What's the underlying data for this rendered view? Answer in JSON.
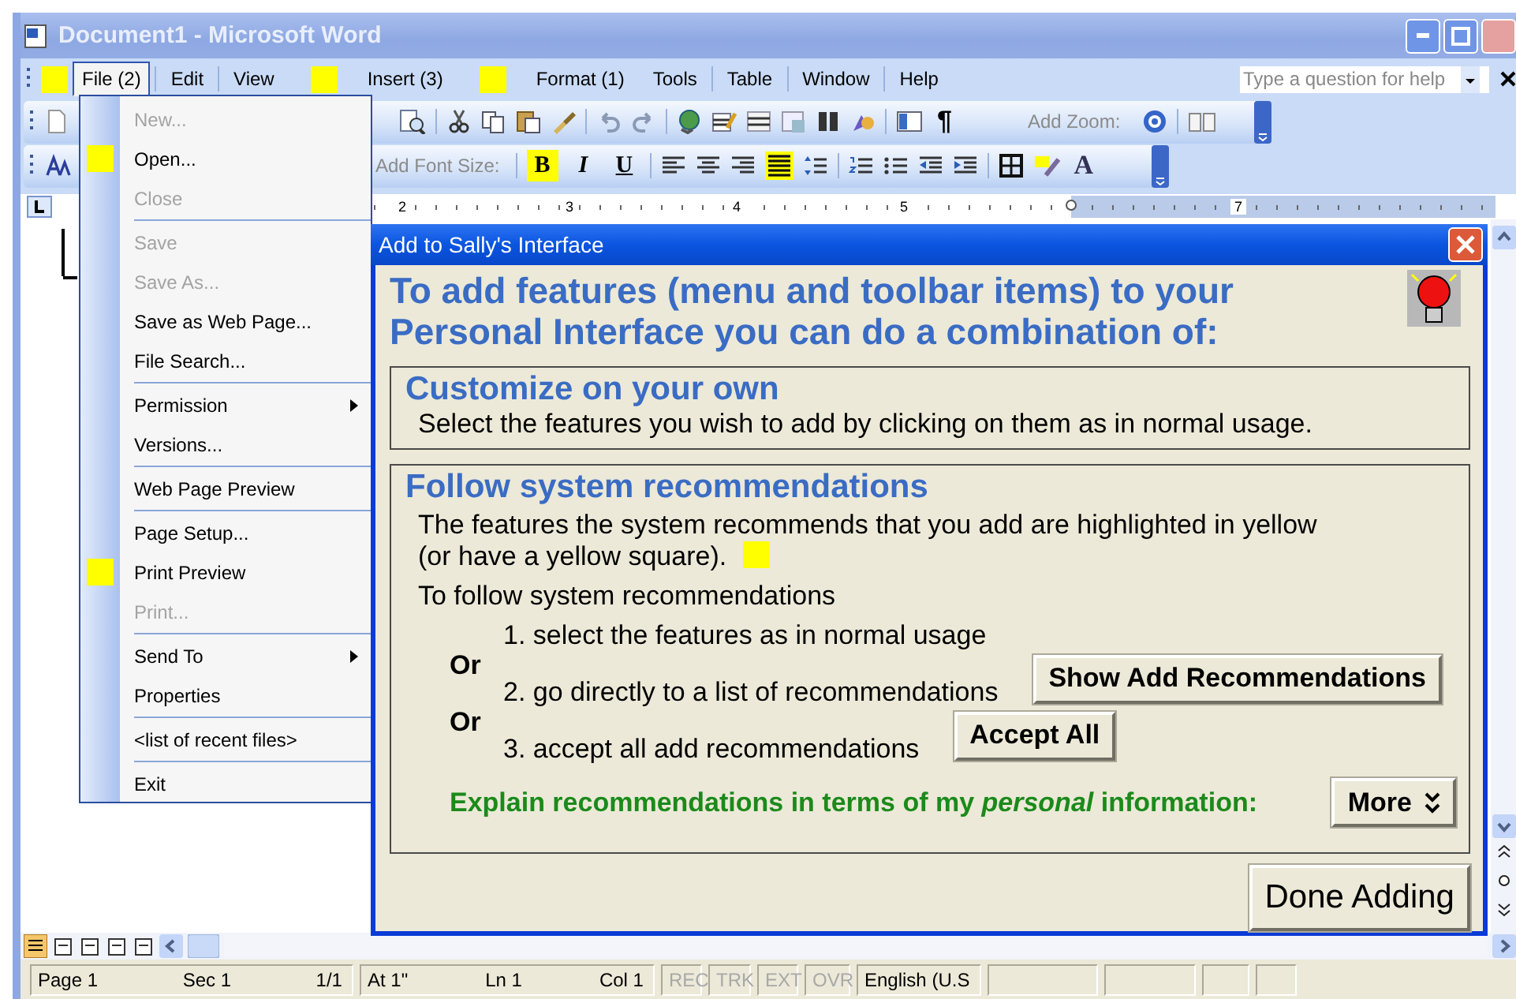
{
  "window": {
    "title": "Document1 - Microsoft Word"
  },
  "menu_bar": {
    "items": [
      {
        "label": "File (2)",
        "recommended": true,
        "selected": true
      },
      {
        "label": "Edit",
        "recommended": false,
        "selected": false
      },
      {
        "label": "View",
        "recommended": false,
        "selected": false
      },
      {
        "label": "Insert (3)",
        "recommended": true,
        "selected": false
      },
      {
        "label": "Format (1)",
        "recommended": true,
        "selected": false
      },
      {
        "label": "Tools",
        "recommended": false,
        "selected": false
      },
      {
        "label": "Table",
        "recommended": false,
        "selected": false
      },
      {
        "label": "Window",
        "recommended": false,
        "selected": false
      },
      {
        "label": "Help",
        "recommended": false,
        "selected": false
      }
    ],
    "help_search": {
      "placeholder": "Type a question for help"
    }
  },
  "standard_toolbar": {
    "pilcrow": "¶",
    "zoom_label": "Add Zoom:"
  },
  "formatting_toolbar": {
    "font_size_label": "Add Font Size:",
    "text_buttons": [
      {
        "label": "B",
        "recommended": true
      },
      {
        "label": "I",
        "recommended": false
      },
      {
        "label": "U",
        "recommended": false
      }
    ],
    "justify_recommended": true,
    "font_color_label": "A"
  },
  "ruler": {
    "marks": [
      {
        "kind": "number",
        "label": "2"
      },
      {
        "kind": "number",
        "label": "3"
      },
      {
        "kind": "number",
        "label": "4"
      },
      {
        "kind": "number",
        "label": "5"
      },
      {
        "kind": "indent-marker"
      },
      {
        "kind": "number",
        "label": "7"
      }
    ]
  },
  "file_menu": {
    "groups": [
      [
        {
          "label": "New...",
          "disabled": true,
          "recommended": false,
          "submenu": false
        },
        {
          "label": "Open...",
          "disabled": false,
          "recommended": true,
          "submenu": false
        },
        {
          "label": "Close",
          "disabled": true,
          "recommended": false,
          "submenu": false
        }
      ],
      [
        {
          "label": "Save",
          "disabled": true,
          "recommended": false,
          "submenu": false
        },
        {
          "label": "Save As...",
          "disabled": true,
          "recommended": false,
          "submenu": false
        },
        {
          "label": "Save as Web Page...",
          "disabled": false,
          "recommended": false,
          "submenu": false
        },
        {
          "label": "File Search...",
          "disabled": false,
          "recommended": false,
          "submenu": false
        }
      ],
      [
        {
          "label": "Permission",
          "disabled": false,
          "recommended": false,
          "submenu": true
        },
        {
          "label": "Versions...",
          "disabled": false,
          "recommended": false,
          "submenu": false
        }
      ],
      [
        {
          "label": "Web Page Preview",
          "disabled": false,
          "recommended": false,
          "submenu": false
        }
      ],
      [
        {
          "label": "Page Setup...",
          "disabled": false,
          "recommended": false,
          "submenu": false
        },
        {
          "label": "Print Preview",
          "disabled": false,
          "recommended": true,
          "submenu": false
        },
        {
          "label": "Print...",
          "disabled": true,
          "recommended": false,
          "submenu": false
        }
      ],
      [
        {
          "label": "Send To",
          "disabled": false,
          "recommended": false,
          "submenu": true
        },
        {
          "label": "Properties",
          "disabled": false,
          "recommended": false,
          "submenu": false
        }
      ],
      [
        {
          "label": "<list of recent files>",
          "disabled": false,
          "recommended": false,
          "submenu": false
        }
      ],
      [
        {
          "label": "Exit",
          "disabled": false,
          "recommended": false,
          "submenu": false
        }
      ]
    ]
  },
  "dialog": {
    "title": "Add to Sally's Interface",
    "heading": "To add features (menu and toolbar items) to your Personal Interface you can do a combination of:",
    "customize": {
      "title": "Customize on your own",
      "text": "Select the features you wish to add by clicking on them as in normal usage."
    },
    "follow": {
      "title": "Follow system recommendations",
      "text_lines": [
        "The features the system recommends that you add are highlighted in yellow",
        "(or have a yellow square)."
      ],
      "intro": "To follow system recommendations",
      "steps": [
        {
          "kind": "step",
          "text": "1. select the features as in normal usage"
        },
        {
          "kind": "connector",
          "text": "Or"
        },
        {
          "kind": "step",
          "text": "2. go directly to a list of recommendations",
          "button": "Show Add Recommendations"
        },
        {
          "kind": "connector",
          "text": "Or"
        },
        {
          "kind": "step",
          "text": "3. accept all add recommendations",
          "button": "Accept All"
        }
      ],
      "explain": "Explain recommendations in terms of my *personal* information:",
      "more_button": "More"
    },
    "done_button": "Done Adding"
  },
  "status_bar": {
    "panels": [
      {
        "cells": [
          {
            "text": "Page 1",
            "disabled": false
          },
          {
            "text": "Sec 1",
            "disabled": false
          },
          {
            "text": "1/1",
            "disabled": false
          }
        ]
      },
      {
        "cells": [
          {
            "text": "At 1\"",
            "disabled": false
          },
          {
            "text": "Ln 1",
            "disabled": false
          },
          {
            "text": "Col 1",
            "disabled": false
          }
        ]
      },
      {
        "cells": [
          {
            "text": "REC",
            "disabled": true
          }
        ]
      },
      {
        "cells": [
          {
            "text": "TRK",
            "disabled": true
          }
        ]
      },
      {
        "cells": [
          {
            "text": "EXT",
            "disabled": true
          }
        ]
      },
      {
        "cells": [
          {
            "text": "OVR",
            "disabled": true
          }
        ]
      },
      {
        "cells": [
          {
            "text": "English (U.S",
            "disabled": false
          }
        ]
      }
    ]
  }
}
